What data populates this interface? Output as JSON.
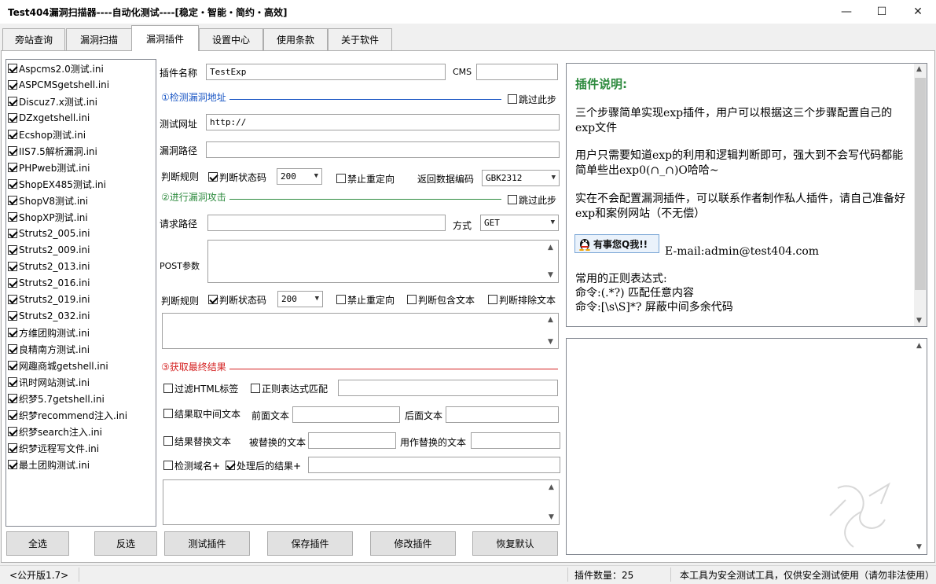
{
  "window": {
    "title": "Test404漏洞扫描器----自动化测试----[稳定・智能・简约・高效]",
    "minimize_glyph": "—",
    "maximize_glyph": "☐",
    "close_glyph": "✕"
  },
  "tabs": [
    {
      "label": "旁站查询"
    },
    {
      "label": "漏洞扫描"
    },
    {
      "label": "漏洞插件"
    },
    {
      "label": "设置中心"
    },
    {
      "label": "使用条款"
    },
    {
      "label": "关于软件"
    }
  ],
  "plugin_list": [
    "Aspcms2.0测试.ini",
    "ASPCMSgetshell.ini",
    "Discuz7.x测试.ini",
    "DZxgetshell.ini",
    "Ecshop测试.ini",
    "IIS7.5解析漏洞.ini",
    "PHPweb测试.ini",
    "ShopEX485测试.ini",
    "ShopV8测试.ini",
    "ShopXP测试.ini",
    "Struts2_005.ini",
    "Struts2_009.ini",
    "Struts2_013.ini",
    "Struts2_016.ini",
    "Struts2_019.ini",
    "Struts2_032.ini",
    "方维团购测试.ini",
    "良精南方测试.ini",
    "网趣商城getshell.ini",
    "讯时网站测试.ini",
    "织梦5.7getshell.ini",
    "织梦recommend注入.ini",
    "织梦search注入.ini",
    "织梦远程写文件.ini",
    "最土团购测试.ini"
  ],
  "form": {
    "plugin_name_label": "插件名称",
    "plugin_name_value": "TestExp",
    "cms_label": "CMS",
    "cms_value": "",
    "section1": "①检测漏洞地址",
    "skip1": "跳过此步",
    "test_url_label": "测试网址",
    "test_url_value": "http://",
    "vuln_path_label": "漏洞路径",
    "vuln_path_value": "",
    "rule1_label": "判断规则",
    "rule1_check_status": "判断状态码",
    "rule1_status_value": "200",
    "rule1_no_redirect": "禁止重定向",
    "encoding_label": "返回数据编码",
    "encoding_value": "GBK2312",
    "section2": "②进行漏洞攻击",
    "skip2": "跳过此步",
    "req_path_label": "请求路径",
    "req_path_value": "",
    "method_label": "方式",
    "method_value": "GET",
    "post_label": "POST参数",
    "rule2_label": "判断规则",
    "rule2_check_status": "判断状态码",
    "rule2_status_value": "200",
    "rule2_no_redirect": "禁止重定向",
    "rule2_contains": "判断包含文本",
    "rule2_excludes": "判断排除文本",
    "section3": "③获取最终结果",
    "filter_html": "过滤HTML标签",
    "regex_match": "正则表达式匹配",
    "mid_text": "结果取中间文本",
    "front_text_label": "前面文本",
    "back_text_label": "后面文本",
    "replace_text": "结果替换文本",
    "replaced_label": "被替换的文本",
    "replace_with_label": "用作替换的文本",
    "check_domain": "检测域名+",
    "processed_result": "处理后的结果+"
  },
  "buttons": {
    "select_all": "全选",
    "invert": "反选",
    "test_plugin": "测试插件",
    "save_plugin": "保存插件",
    "edit_plugin": "修改插件",
    "restore_default": "恢复默认"
  },
  "info": {
    "title": "插件说明:",
    "p1": "三个步骤简单实现exp插件，用户可以根据这三个步骤配置自己的exp文件",
    "p2": "用户只需要知道exp的利用和逻辑判断即可，强大到不会写代码都能简单些出exp0(∩_∩)O哈哈~",
    "p3": "实在不会配置漏洞插件，可以联系作者制作私人插件，请自己准备好exp和案例网站（不无偿）",
    "qq_button": "有事您Q我!!",
    "email": "E-mail:admin@test404.com",
    "regex_title": "常用的正则表达式:",
    "regex1": "命令:(.*?) 匹配任意内容",
    "regex2": "命令:[\\s\\S]*? 屏蔽中间多余代码"
  },
  "status": {
    "version": "<公开版1.7>",
    "plugin_count": "插件数量：25",
    "notice": "本工具为安全测试工具，仅供安全测试使用（请勿非法使用）"
  },
  "colors": {
    "section1": "#1a56c4",
    "section2": "#2e8b3f",
    "section3": "#d42020",
    "info_title": "#2e8b3f"
  }
}
